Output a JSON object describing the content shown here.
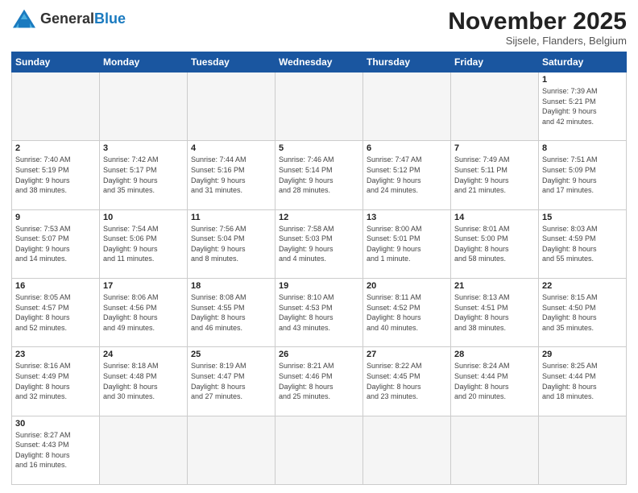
{
  "header": {
    "logo_general": "General",
    "logo_blue": "Blue",
    "month_title": "November 2025",
    "subtitle": "Sijsele, Flanders, Belgium"
  },
  "days_of_week": [
    "Sunday",
    "Monday",
    "Tuesday",
    "Wednesday",
    "Thursday",
    "Friday",
    "Saturday"
  ],
  "weeks": [
    [
      {
        "day": "",
        "info": "",
        "empty": true
      },
      {
        "day": "",
        "info": "",
        "empty": true
      },
      {
        "day": "",
        "info": "",
        "empty": true
      },
      {
        "day": "",
        "info": "",
        "empty": true
      },
      {
        "day": "",
        "info": "",
        "empty": true
      },
      {
        "day": "",
        "info": "",
        "empty": true
      },
      {
        "day": "1",
        "info": "Sunrise: 7:39 AM\nSunset: 5:21 PM\nDaylight: 9 hours\nand 42 minutes.",
        "empty": false
      }
    ],
    [
      {
        "day": "2",
        "info": "Sunrise: 7:40 AM\nSunset: 5:19 PM\nDaylight: 9 hours\nand 38 minutes.",
        "empty": false
      },
      {
        "day": "3",
        "info": "Sunrise: 7:42 AM\nSunset: 5:17 PM\nDaylight: 9 hours\nand 35 minutes.",
        "empty": false
      },
      {
        "day": "4",
        "info": "Sunrise: 7:44 AM\nSunset: 5:16 PM\nDaylight: 9 hours\nand 31 minutes.",
        "empty": false
      },
      {
        "day": "5",
        "info": "Sunrise: 7:46 AM\nSunset: 5:14 PM\nDaylight: 9 hours\nand 28 minutes.",
        "empty": false
      },
      {
        "day": "6",
        "info": "Sunrise: 7:47 AM\nSunset: 5:12 PM\nDaylight: 9 hours\nand 24 minutes.",
        "empty": false
      },
      {
        "day": "7",
        "info": "Sunrise: 7:49 AM\nSunset: 5:11 PM\nDaylight: 9 hours\nand 21 minutes.",
        "empty": false
      },
      {
        "day": "8",
        "info": "Sunrise: 7:51 AM\nSunset: 5:09 PM\nDaylight: 9 hours\nand 17 minutes.",
        "empty": false
      }
    ],
    [
      {
        "day": "9",
        "info": "Sunrise: 7:53 AM\nSunset: 5:07 PM\nDaylight: 9 hours\nand 14 minutes.",
        "empty": false
      },
      {
        "day": "10",
        "info": "Sunrise: 7:54 AM\nSunset: 5:06 PM\nDaylight: 9 hours\nand 11 minutes.",
        "empty": false
      },
      {
        "day": "11",
        "info": "Sunrise: 7:56 AM\nSunset: 5:04 PM\nDaylight: 9 hours\nand 8 minutes.",
        "empty": false
      },
      {
        "day": "12",
        "info": "Sunrise: 7:58 AM\nSunset: 5:03 PM\nDaylight: 9 hours\nand 4 minutes.",
        "empty": false
      },
      {
        "day": "13",
        "info": "Sunrise: 8:00 AM\nSunset: 5:01 PM\nDaylight: 9 hours\nand 1 minute.",
        "empty": false
      },
      {
        "day": "14",
        "info": "Sunrise: 8:01 AM\nSunset: 5:00 PM\nDaylight: 8 hours\nand 58 minutes.",
        "empty": false
      },
      {
        "day": "15",
        "info": "Sunrise: 8:03 AM\nSunset: 4:59 PM\nDaylight: 8 hours\nand 55 minutes.",
        "empty": false
      }
    ],
    [
      {
        "day": "16",
        "info": "Sunrise: 8:05 AM\nSunset: 4:57 PM\nDaylight: 8 hours\nand 52 minutes.",
        "empty": false
      },
      {
        "day": "17",
        "info": "Sunrise: 8:06 AM\nSunset: 4:56 PM\nDaylight: 8 hours\nand 49 minutes.",
        "empty": false
      },
      {
        "day": "18",
        "info": "Sunrise: 8:08 AM\nSunset: 4:55 PM\nDaylight: 8 hours\nand 46 minutes.",
        "empty": false
      },
      {
        "day": "19",
        "info": "Sunrise: 8:10 AM\nSunset: 4:53 PM\nDaylight: 8 hours\nand 43 minutes.",
        "empty": false
      },
      {
        "day": "20",
        "info": "Sunrise: 8:11 AM\nSunset: 4:52 PM\nDaylight: 8 hours\nand 40 minutes.",
        "empty": false
      },
      {
        "day": "21",
        "info": "Sunrise: 8:13 AM\nSunset: 4:51 PM\nDaylight: 8 hours\nand 38 minutes.",
        "empty": false
      },
      {
        "day": "22",
        "info": "Sunrise: 8:15 AM\nSunset: 4:50 PM\nDaylight: 8 hours\nand 35 minutes.",
        "empty": false
      }
    ],
    [
      {
        "day": "23",
        "info": "Sunrise: 8:16 AM\nSunset: 4:49 PM\nDaylight: 8 hours\nand 32 minutes.",
        "empty": false
      },
      {
        "day": "24",
        "info": "Sunrise: 8:18 AM\nSunset: 4:48 PM\nDaylight: 8 hours\nand 30 minutes.",
        "empty": false
      },
      {
        "day": "25",
        "info": "Sunrise: 8:19 AM\nSunset: 4:47 PM\nDaylight: 8 hours\nand 27 minutes.",
        "empty": false
      },
      {
        "day": "26",
        "info": "Sunrise: 8:21 AM\nSunset: 4:46 PM\nDaylight: 8 hours\nand 25 minutes.",
        "empty": false
      },
      {
        "day": "27",
        "info": "Sunrise: 8:22 AM\nSunset: 4:45 PM\nDaylight: 8 hours\nand 23 minutes.",
        "empty": false
      },
      {
        "day": "28",
        "info": "Sunrise: 8:24 AM\nSunset: 4:44 PM\nDaylight: 8 hours\nand 20 minutes.",
        "empty": false
      },
      {
        "day": "29",
        "info": "Sunrise: 8:25 AM\nSunset: 4:44 PM\nDaylight: 8 hours\nand 18 minutes.",
        "empty": false
      }
    ],
    [
      {
        "day": "30",
        "info": "Sunrise: 8:27 AM\nSunset: 4:43 PM\nDaylight: 8 hours\nand 16 minutes.",
        "empty": false
      },
      {
        "day": "",
        "info": "",
        "empty": true
      },
      {
        "day": "",
        "info": "",
        "empty": true
      },
      {
        "day": "",
        "info": "",
        "empty": true
      },
      {
        "day": "",
        "info": "",
        "empty": true
      },
      {
        "day": "",
        "info": "",
        "empty": true
      },
      {
        "day": "",
        "info": "",
        "empty": true
      }
    ]
  ]
}
